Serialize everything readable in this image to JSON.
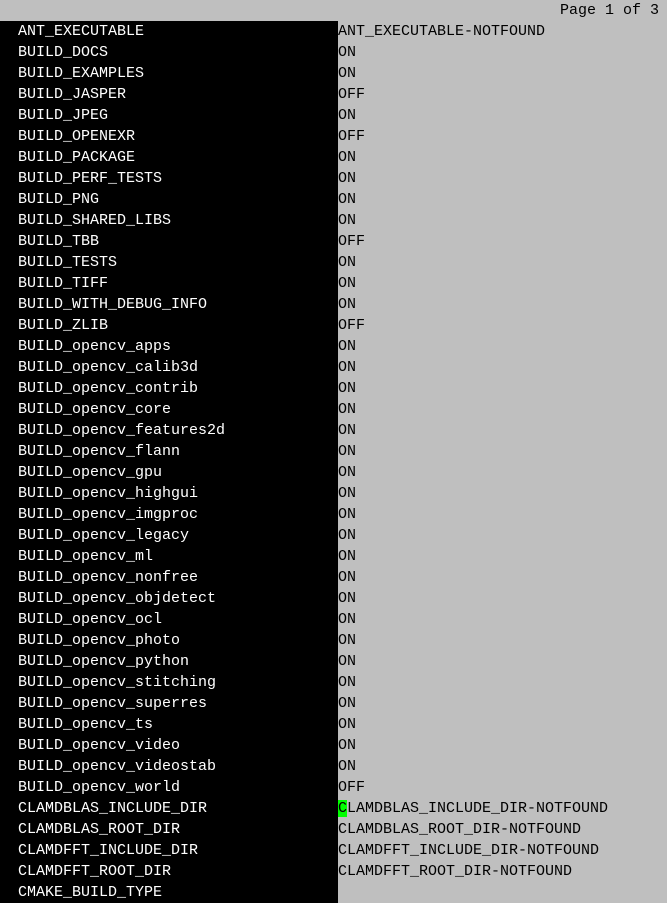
{
  "header": {
    "page_text": "Page 1 of 3"
  },
  "cursor_row_index": 37,
  "rows": [
    {
      "key": "ANT_EXECUTABLE",
      "value": "ANT_EXECUTABLE-NOTFOUND"
    },
    {
      "key": "BUILD_DOCS",
      "value": "ON"
    },
    {
      "key": "BUILD_EXAMPLES",
      "value": "ON"
    },
    {
      "key": "BUILD_JASPER",
      "value": "OFF"
    },
    {
      "key": "BUILD_JPEG",
      "value": "ON"
    },
    {
      "key": "BUILD_OPENEXR",
      "value": "OFF"
    },
    {
      "key": "BUILD_PACKAGE",
      "value": "ON"
    },
    {
      "key": "BUILD_PERF_TESTS",
      "value": "ON"
    },
    {
      "key": "BUILD_PNG",
      "value": "ON"
    },
    {
      "key": "BUILD_SHARED_LIBS",
      "value": "ON"
    },
    {
      "key": "BUILD_TBB",
      "value": "OFF"
    },
    {
      "key": "BUILD_TESTS",
      "value": "ON"
    },
    {
      "key": "BUILD_TIFF",
      "value": "ON"
    },
    {
      "key": "BUILD_WITH_DEBUG_INFO",
      "value": "ON"
    },
    {
      "key": "BUILD_ZLIB",
      "value": "OFF"
    },
    {
      "key": "BUILD_opencv_apps",
      "value": "ON"
    },
    {
      "key": "BUILD_opencv_calib3d",
      "value": "ON"
    },
    {
      "key": "BUILD_opencv_contrib",
      "value": "ON"
    },
    {
      "key": "BUILD_opencv_core",
      "value": "ON"
    },
    {
      "key": "BUILD_opencv_features2d",
      "value": "ON"
    },
    {
      "key": "BUILD_opencv_flann",
      "value": "ON"
    },
    {
      "key": "BUILD_opencv_gpu",
      "value": "ON"
    },
    {
      "key": "BUILD_opencv_highgui",
      "value": "ON"
    },
    {
      "key": "BUILD_opencv_imgproc",
      "value": "ON"
    },
    {
      "key": "BUILD_opencv_legacy",
      "value": "ON"
    },
    {
      "key": "BUILD_opencv_ml",
      "value": "ON"
    },
    {
      "key": "BUILD_opencv_nonfree",
      "value": "ON"
    },
    {
      "key": "BUILD_opencv_objdetect",
      "value": "ON"
    },
    {
      "key": "BUILD_opencv_ocl",
      "value": "ON"
    },
    {
      "key": "BUILD_opencv_photo",
      "value": "ON"
    },
    {
      "key": "BUILD_opencv_python",
      "value": "ON"
    },
    {
      "key": "BUILD_opencv_stitching",
      "value": "ON"
    },
    {
      "key": "BUILD_opencv_superres",
      "value": "ON"
    },
    {
      "key": "BUILD_opencv_ts",
      "value": "ON"
    },
    {
      "key": "BUILD_opencv_video",
      "value": "ON"
    },
    {
      "key": "BUILD_opencv_videostab",
      "value": "ON"
    },
    {
      "key": "BUILD_opencv_world",
      "value": "OFF"
    },
    {
      "key": "CLAMDBLAS_INCLUDE_DIR",
      "value": "CLAMDBLAS_INCLUDE_DIR-NOTFOUND"
    },
    {
      "key": "CLAMDBLAS_ROOT_DIR",
      "value": "CLAMDBLAS_ROOT_DIR-NOTFOUND"
    },
    {
      "key": "CLAMDFFT_INCLUDE_DIR",
      "value": "CLAMDFFT_INCLUDE_DIR-NOTFOUND"
    },
    {
      "key": "CLAMDFFT_ROOT_DIR",
      "value": "CLAMDFFT_ROOT_DIR-NOTFOUND"
    },
    {
      "key": "CMAKE_BUILD_TYPE",
      "value": ""
    }
  ]
}
